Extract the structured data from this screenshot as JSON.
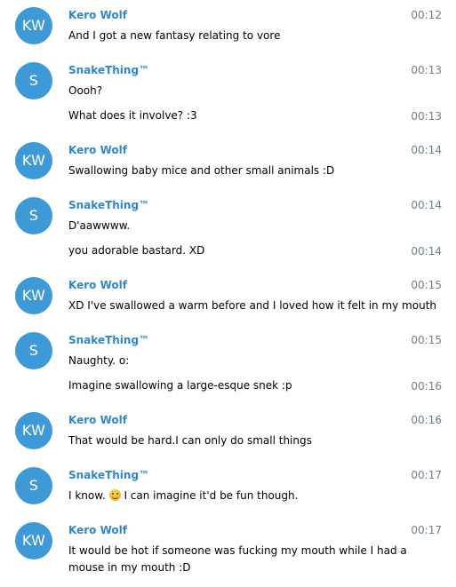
{
  "messages": [
    {
      "avatar": "KW",
      "sender": "Kero Wolf",
      "time": "00:12",
      "text": "And I got a new fantasy relating to vore"
    },
    {
      "avatar": "S",
      "sender": "SnakeThing™",
      "time": "00:13",
      "text": "Oooh?"
    },
    {
      "avatar": "",
      "sender": "",
      "time": "00:13",
      "text": "What does it involve? :3"
    },
    {
      "avatar": "KW",
      "sender": "Kero Wolf",
      "time": "00:14",
      "text": "Swallowing baby mice and other small animals :D"
    },
    {
      "avatar": "S",
      "sender": "SnakeThing™",
      "time": "00:14",
      "text": "D'aawwww."
    },
    {
      "avatar": "",
      "sender": "",
      "time": "00:14",
      "text": "you adorable bastard. XD"
    },
    {
      "avatar": "KW",
      "sender": "Kero Wolf",
      "time": "00:15",
      "text": "XD I've swallowed a warm before and I loved how it felt in my mouth"
    },
    {
      "avatar": "S",
      "sender": "SnakeThing™",
      "time": "00:15",
      "text": "Naughty. o:"
    },
    {
      "avatar": "",
      "sender": "",
      "time": "00:16",
      "text": "Imagine swallowing a large-esque snek :p"
    },
    {
      "avatar": "KW",
      "sender": "Kero Wolf",
      "time": "00:16",
      "text": "That would be hard.I can only do small things"
    },
    {
      "avatar": "S",
      "sender": "SnakeThing™",
      "time": "00:17",
      "text_before": "I know.",
      "emoji": "smile-emoji",
      "text_after": "I can imagine it'd be fun though."
    },
    {
      "avatar": "KW",
      "sender": "Kero Wolf",
      "time": "00:17",
      "text": "It would be hot if someone was fucking my mouth while I had a mouse in my mouth :D"
    }
  ]
}
